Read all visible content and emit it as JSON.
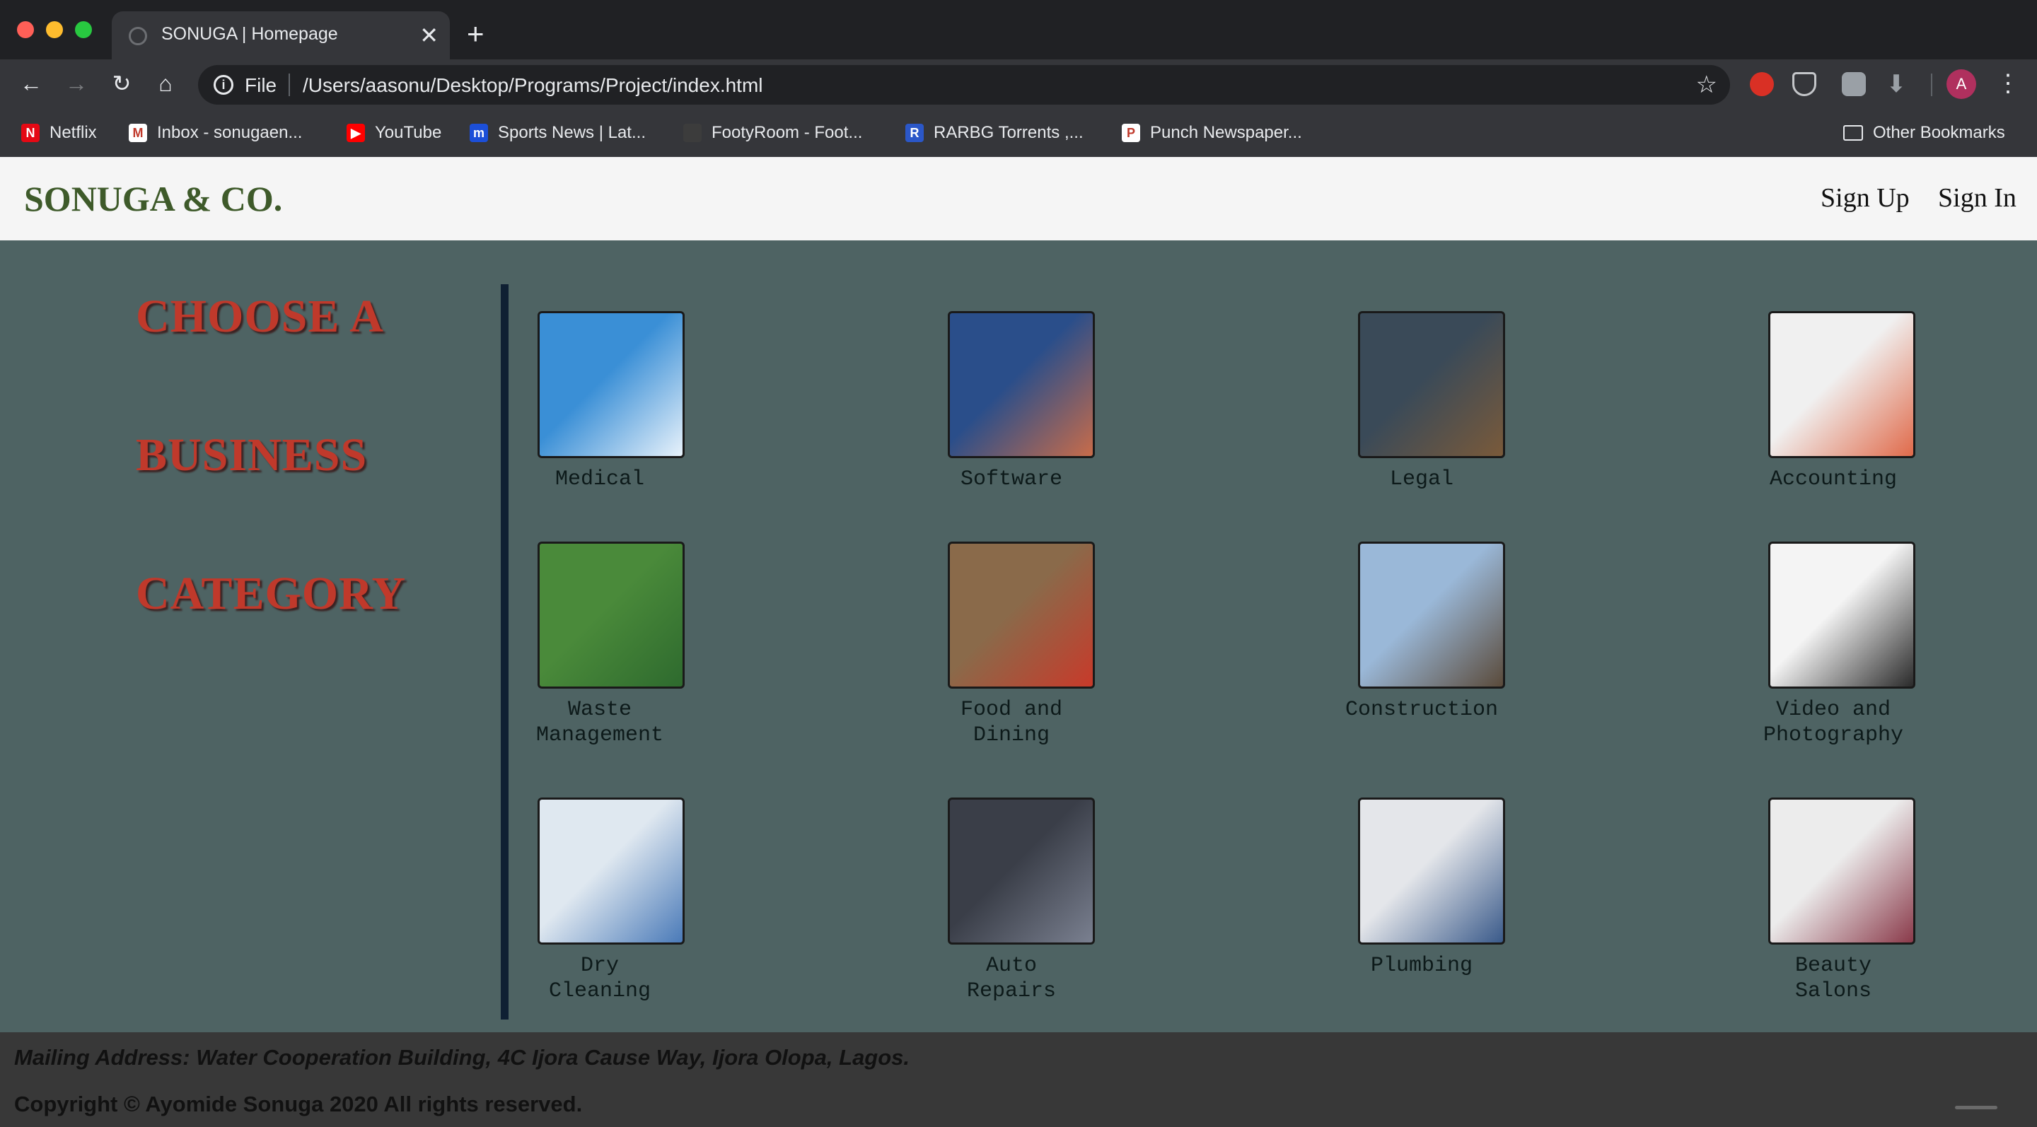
{
  "browser": {
    "tab_title": "SONUGA | Homepage",
    "scheme_label": "File",
    "url": "/Users/aasonu/Desktop/Programs/Project/index.html",
    "profile_initial": "A",
    "bookmarks": [
      {
        "label": "Netflix",
        "icon": "netflix-icon",
        "color": "#e50914",
        "glyph": "N"
      },
      {
        "label": "Inbox - sonugaen...",
        "icon": "gmail-icon",
        "color": "#ffffff",
        "glyph": "M"
      },
      {
        "label": "YouTube",
        "icon": "youtube-icon",
        "color": "#ff0000",
        "glyph": "▶"
      },
      {
        "label": "Sports News | Lat...",
        "icon": "sports-news-icon",
        "color": "#1c4fd8",
        "glyph": "m"
      },
      {
        "label": "FootyRoom - Foot...",
        "icon": "footyroom-icon",
        "color": "#3c3c3c",
        "glyph": ""
      },
      {
        "label": "RARBG Torrents ,...",
        "icon": "rarbg-icon",
        "color": "#2b57c8",
        "glyph": "R"
      },
      {
        "label": "Punch Newspaper...",
        "icon": "punch-icon",
        "color": "#ffffff",
        "glyph": "P"
      }
    ],
    "other_bookmarks": "Other Bookmarks"
  },
  "header": {
    "brand": "SONUGA & CO.",
    "sign_up": "Sign Up",
    "sign_in": "Sign In"
  },
  "main": {
    "heading_lines": [
      "CHOOSE A",
      "BUSINESS",
      "CATEGORY"
    ],
    "categories": [
      {
        "label": "Medical",
        "image": "medical-image",
        "colors": [
          "#3a8fd6",
          "#e8f2fb"
        ]
      },
      {
        "label": "Software",
        "image": "software-image",
        "colors": [
          "#2a4e8a",
          "#c86c4a"
        ]
      },
      {
        "label": "Legal",
        "image": "legal-image",
        "colors": [
          "#3a4a58",
          "#7a5a3a"
        ]
      },
      {
        "label": "Accounting",
        "image": "accounting-image",
        "colors": [
          "#f0f0f0",
          "#e06a4a"
        ]
      },
      {
        "label": "Waste\nManagement",
        "image": "waste-management-image",
        "colors": [
          "#4a8a3a",
          "#2e6a2e"
        ]
      },
      {
        "label": "Food and\nDining",
        "image": "food-dining-image",
        "colors": [
          "#8a6a4a",
          "#c83a2a"
        ]
      },
      {
        "label": "Construction",
        "image": "construction-image",
        "colors": [
          "#9ab8d8",
          "#5a4a3a"
        ]
      },
      {
        "label": "Video and\nPhotography",
        "image": "video-photography-image",
        "colors": [
          "#f4f4f4",
          "#2a2a2a"
        ]
      },
      {
        "label": "Dry\nCleaning",
        "image": "dry-cleaning-image",
        "colors": [
          "#dfe8f0",
          "#4a7ab8"
        ]
      },
      {
        "label": "Auto\nRepairs",
        "image": "auto-repairs-image",
        "colors": [
          "#3a3e48",
          "#7a8090"
        ]
      },
      {
        "label": "Plumbing",
        "image": "plumbing-image",
        "colors": [
          "#e4e6ea",
          "#3a5a8a"
        ]
      },
      {
        "label": "Beauty\nSalons",
        "image": "beauty-salons-image",
        "colors": [
          "#ececec",
          "#8a3a4a"
        ]
      }
    ]
  },
  "footer": {
    "address": "Mailing Address: Water Cooperation Building, 4C Ijora Cause Way, Ijora Olopa, Lagos.",
    "copyright": "Copyright © Ayomide Sonuga 2020 All rights reserved."
  }
}
